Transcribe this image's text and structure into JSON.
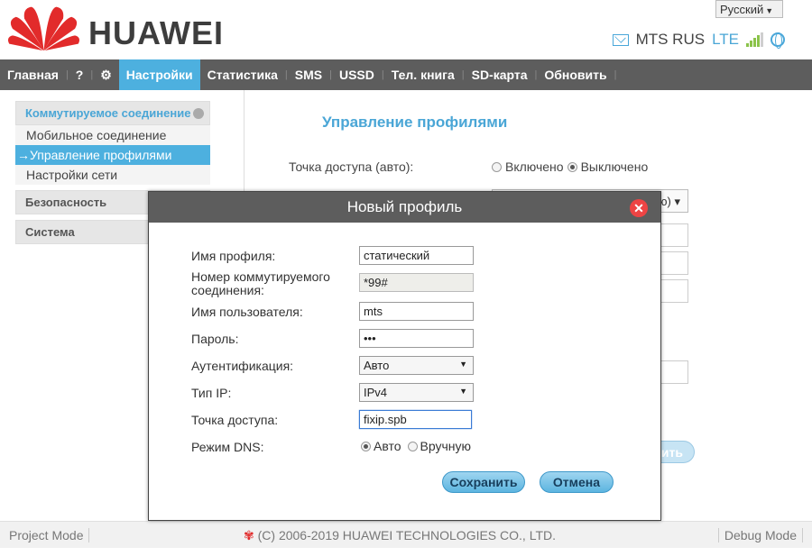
{
  "header": {
    "brand": "HUAWEI",
    "language": "Русский",
    "operator": "MTS RUS",
    "network": "LTE",
    "signal_level": 0.8
  },
  "nav": {
    "items": [
      {
        "label": "Главная"
      },
      {
        "label": "?"
      },
      {
        "label": "Настройки",
        "active": true
      },
      {
        "label": "Статистика"
      },
      {
        "label": "SMS"
      },
      {
        "label": "USSD"
      },
      {
        "label": "Тел. книга"
      },
      {
        "label": "SD-карта"
      },
      {
        "label": "Обновить"
      }
    ]
  },
  "sidebar": {
    "group1": "Коммутируемое соединение",
    "sub": [
      "Мобильное соединение",
      "Управление профилями",
      "Настройки сети"
    ],
    "group2": "Безопасность",
    "group3": "Система"
  },
  "main": {
    "title": "Управление профилями",
    "apn_auto_label": "Точка доступа (авто):",
    "on_label": "Включено",
    "off_label": "Выключено",
    "select_fragment": "ю)",
    "button_fragment": "ить"
  },
  "dialog": {
    "title": "Новый профиль",
    "close": "✕",
    "fields": {
      "profile_name": {
        "label": "Имя профиля:",
        "value": "статический"
      },
      "dial_number": {
        "label": "Номер коммутируемого соединения:",
        "value": "*99#"
      },
      "username": {
        "label": "Имя пользователя:",
        "value": "mts"
      },
      "password": {
        "label": "Пароль:",
        "value": "•••"
      },
      "auth": {
        "label": "Аутентификация:",
        "value": "Авто"
      },
      "ip_type": {
        "label": "Тип IP:",
        "value": "IPv4"
      },
      "apn": {
        "label": "Точка доступа:",
        "value": "fixip.spb"
      },
      "dns": {
        "label": "Режим DNS:",
        "auto": "Авто",
        "manual": "Вручную"
      }
    },
    "save": "Сохранить",
    "cancel": "Отмена"
  },
  "footer": {
    "project_mode": "Project Mode",
    "copyright": "(C) 2006-2019 HUAWEI TECHNOLOGIES CO., LTD.",
    "debug_mode": "Debug Mode"
  },
  "colors": {
    "accent": "#4db0df",
    "nav_bg": "#5d5d5d",
    "brand_red": "#e22b2b"
  }
}
